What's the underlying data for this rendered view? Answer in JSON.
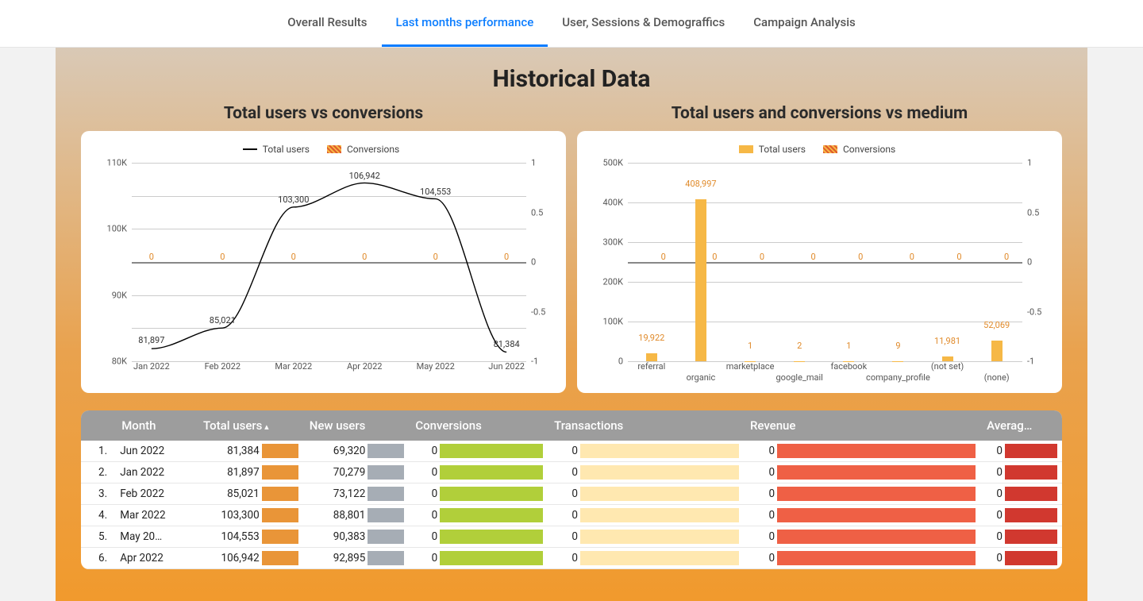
{
  "tabs": [
    {
      "label": "Overall Results",
      "active": false
    },
    {
      "label": "Last months performance",
      "active": true
    },
    {
      "label": "User, Sessions & Demograffics",
      "active": false
    },
    {
      "label": "Campaign Analysis",
      "active": false
    }
  ],
  "page_title": "Historical Data",
  "chart1": {
    "heading": "Total users vs conversions",
    "legend": {
      "users": "Total users",
      "conversions": "Conversions"
    }
  },
  "chart2": {
    "heading": "Total users and conversions vs medium",
    "legend": {
      "users": "Total users",
      "conversions": "Conversions"
    }
  },
  "chart_data": [
    {
      "type": "line",
      "title": "Total users vs conversions",
      "x": [
        "Jan 2022",
        "Feb 2022",
        "Mar 2022",
        "Apr 2022",
        "May 2022",
        "Jun 2022"
      ],
      "series": [
        {
          "name": "Total users",
          "axis": "left",
          "values": [
            81897,
            85021,
            103300,
            106942,
            104553,
            81384
          ]
        },
        {
          "name": "Conversions",
          "axis": "right",
          "values": [
            0,
            0,
            0,
            0,
            0,
            0
          ]
        }
      ],
      "y_left": {
        "min": 80000,
        "max": 110000,
        "ticks": [
          "80K",
          "90K",
          "100K",
          "110K"
        ]
      },
      "y_right": {
        "min": -1,
        "max": 1,
        "ticks": [
          "-1",
          "-0.5",
          "0",
          "0.5",
          "1"
        ]
      }
    },
    {
      "type": "bar",
      "title": "Total users and conversions vs medium",
      "categories": [
        "referral",
        "organic",
        "marketplace",
        "google_mail",
        "facebook",
        "company_profile",
        "(not set)",
        "(none)"
      ],
      "series": [
        {
          "name": "Total users",
          "axis": "left",
          "values": [
            19922,
            408997,
            1,
            2,
            1,
            9,
            11981,
            52069
          ]
        },
        {
          "name": "Conversions",
          "axis": "right",
          "values": [
            0,
            0,
            0,
            0,
            0,
            0,
            0,
            0
          ]
        }
      ],
      "y_left": {
        "min": 0,
        "max": 500000,
        "ticks": [
          "0",
          "100K",
          "200K",
          "300K",
          "400K",
          "500K"
        ]
      },
      "y_right": {
        "min": -1,
        "max": 1,
        "ticks": [
          "-1",
          "-0.5",
          "0",
          "0.5",
          "1"
        ]
      }
    }
  ],
  "table": {
    "headers": [
      "",
      "Month",
      "Total users",
      "New users",
      "Conversions",
      "Transactions",
      "Revenue",
      "Averag…"
    ],
    "sorted_col": 2,
    "rows": [
      {
        "idx": "1.",
        "month": "Jun 2022",
        "total": "81,384",
        "new": "69,320",
        "conv": "0",
        "tx": "0",
        "rev": "0",
        "avg": "0"
      },
      {
        "idx": "2.",
        "month": "Jan 2022",
        "total": "81,897",
        "new": "70,279",
        "conv": "0",
        "tx": "0",
        "rev": "0",
        "avg": "0"
      },
      {
        "idx": "3.",
        "month": "Feb 2022",
        "total": "85,021",
        "new": "73,122",
        "conv": "0",
        "tx": "0",
        "rev": "0",
        "avg": "0"
      },
      {
        "idx": "4.",
        "month": "Mar 2022",
        "total": "103,300",
        "new": "88,801",
        "conv": "0",
        "tx": "0",
        "rev": "0",
        "avg": "0"
      },
      {
        "idx": "5.",
        "month": "May 20…",
        "total": "104,553",
        "new": "90,383",
        "conv": "0",
        "tx": "0",
        "rev": "0",
        "avg": "0"
      },
      {
        "idx": "6.",
        "month": "Apr 2022",
        "total": "106,942",
        "new": "92,895",
        "conv": "0",
        "tx": "0",
        "rev": "0",
        "avg": "0"
      }
    ]
  }
}
